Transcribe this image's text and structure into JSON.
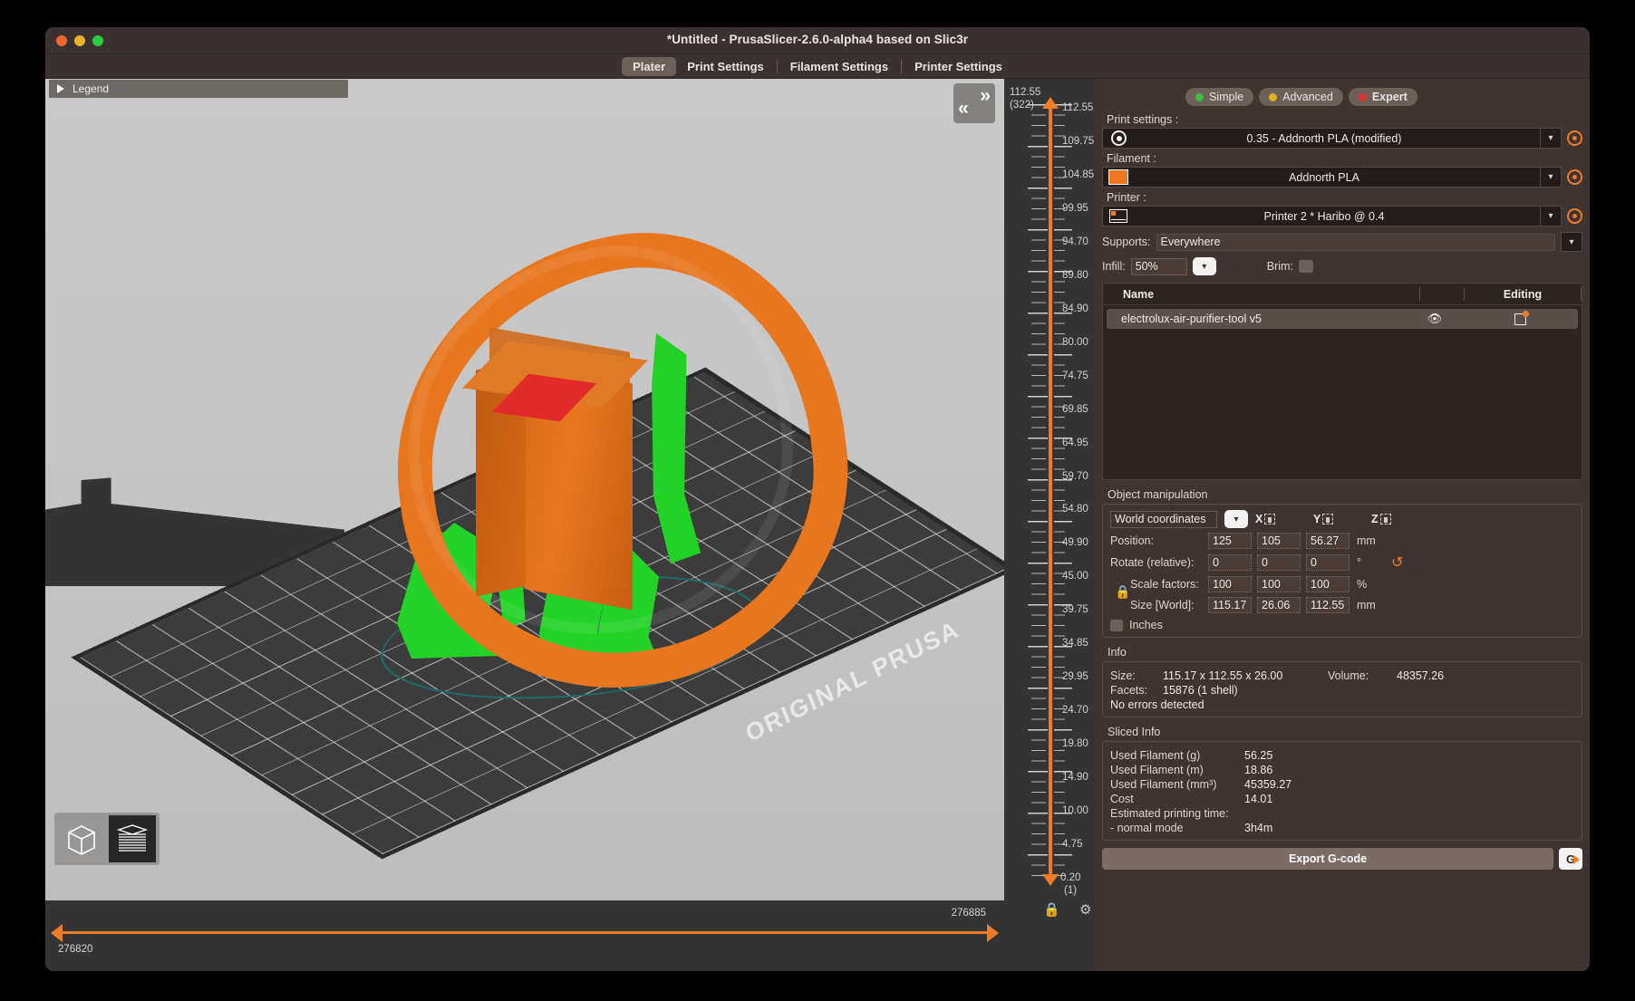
{
  "window": {
    "title": "*Untitled - PrusaSlicer-2.6.0-alpha4 based on Slic3r",
    "traffic": [
      "close-button",
      "minimize-button",
      "maximize-button"
    ]
  },
  "tabs": [
    {
      "label": "Plater",
      "active": true
    },
    {
      "label": "Print Settings",
      "active": false
    },
    {
      "label": "Filament Settings",
      "active": false
    },
    {
      "label": "Printer Settings",
      "active": false
    }
  ],
  "viewport": {
    "legend_label": "Legend",
    "bed_text": "ORIGINAL PRUSA",
    "collapse_right": "»",
    "collapse_left": "«",
    "view_3d_icon": "cube-icon",
    "view_preview_icon": "layers-icon"
  },
  "horizontal_slider": {
    "min_label": "276820",
    "max_label": "276885"
  },
  "layer_slider": {
    "top_value": "112.55",
    "top_layer": "(322)",
    "bottom_value": "0.20",
    "bottom_layer": "(1)",
    "ticks": [
      "112.55",
      "109.75",
      "104.85",
      "99.95",
      "94.70",
      "89.80",
      "84.90",
      "80.00",
      "74.75",
      "69.85",
      "64.95",
      "59.70",
      "54.80",
      "49.90",
      "45.00",
      "39.75",
      "34.85",
      "29.95",
      "24.70",
      "19.80",
      "14.90",
      "10.00",
      "4.75"
    ]
  },
  "mode_buttons": [
    {
      "label": "Simple",
      "color": "#3dbf3d",
      "active": false
    },
    {
      "label": "Advanced",
      "color": "#e0b020",
      "active": false
    },
    {
      "label": "Expert",
      "color": "#e0302a",
      "active": true
    }
  ],
  "presets": {
    "print_settings_label": "Print settings :",
    "print_settings_value": "0.35 - Addnorth PLA (modified)",
    "filament_label": "Filament :",
    "filament_value": "Addnorth PLA",
    "filament_color": "#ed7620",
    "printer_label": "Printer :",
    "printer_value": "Printer 2 * Haribo @ 0.4",
    "supports_label": "Supports:",
    "supports_value": "Everywhere",
    "infill_label": "Infill:",
    "infill_value": "50%",
    "brim_label": "Brim:"
  },
  "object_list": {
    "col_name": "Name",
    "col_editing": "Editing",
    "rows": [
      {
        "name": "electrolux-air-purifier-tool v5",
        "eye": "◉",
        "editing": "edit-icon"
      }
    ]
  },
  "object_manipulation": {
    "title": "Object manipulation",
    "coord_system": "World coordinates",
    "axis_x": "X",
    "axis_y": "Y",
    "axis_z": "Z",
    "position_label": "Position:",
    "position": [
      "125",
      "105",
      "56.27"
    ],
    "position_unit": "mm",
    "rotate_label": "Rotate (relative):",
    "rotate": [
      "0",
      "0",
      "0"
    ],
    "rotate_unit": "°",
    "scale_label": "Scale factors:",
    "scale": [
      "100",
      "100",
      "100"
    ],
    "scale_unit": "%",
    "size_label": "Size [World]:",
    "size": [
      "115.17",
      "26.06",
      "112.55"
    ],
    "size_unit": "mm",
    "inches_label": "Inches"
  },
  "info": {
    "title": "Info",
    "size_key": "Size:",
    "size_value": "115.17 x 112.55 x 26.00",
    "volume_key": "Volume:",
    "volume_value": "48357.26",
    "facets_key": "Facets:",
    "facets_value": "15876 (1 shell)",
    "errors": "No errors detected"
  },
  "sliced_info": {
    "title": "Sliced Info",
    "rows": [
      {
        "key": "Used Filament (g)",
        "value": "56.25"
      },
      {
        "key": "Used Filament (m)",
        "value": "18.86"
      },
      {
        "key": "Used Filament (mm³)",
        "value": "45359.27"
      },
      {
        "key": "Cost",
        "value": "14.01"
      },
      {
        "key": "Estimated printing time:",
        "value": ""
      },
      {
        "key": "  - normal mode",
        "value": "3h4m"
      }
    ]
  },
  "footer": {
    "export_label": "Export G-code",
    "gcode_button": "G"
  }
}
